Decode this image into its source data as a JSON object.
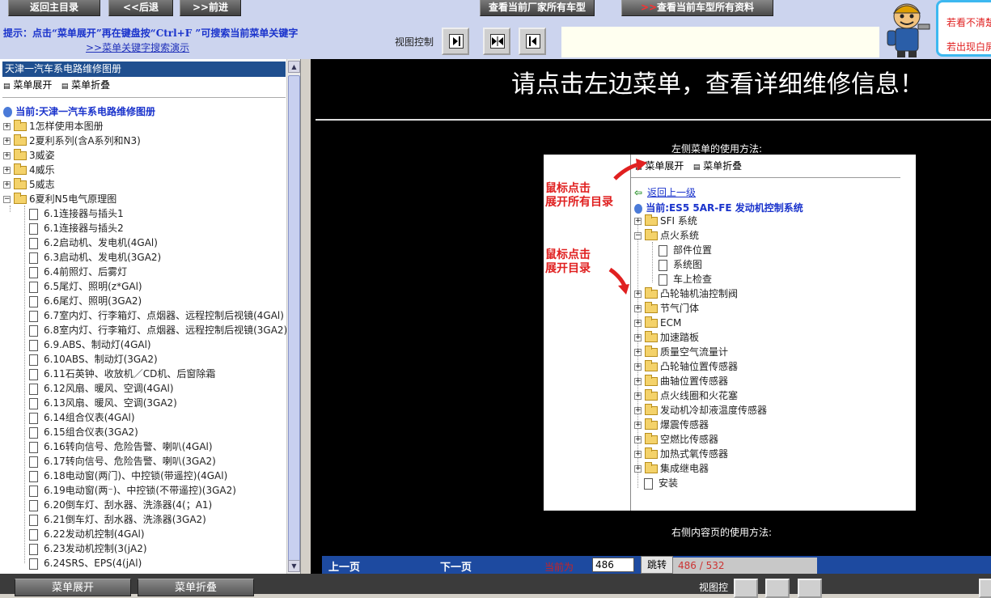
{
  "top": {
    "back_home": "返回主目录",
    "back": "<<后退",
    "forward": ">>前进",
    "all_models": "查看当前厂家所有车型",
    "all_data_arrow": ">>",
    "all_data": "查看当前车型所有资料",
    "hint": "提示：点击“菜单展开”再在键盘按“Ctrl+F ”可搜索当前菜单关键字",
    "hint_link": ">>菜单关键字搜索演示",
    "view_control": "视图控制",
    "promo_line1": "若看不清楚",
    "promo_line2": "若出现白屏"
  },
  "left": {
    "title": "天津一汽车系电路维修图册",
    "expand": "菜单展开",
    "collapse": "菜单折叠",
    "current": "当前:天津一汽车系电路维修图册",
    "folders": [
      "1怎样使用本图册",
      "2夏利系列(含A系列和N3)",
      "3威姿",
      "4威乐",
      "5威志",
      "6夏利N5电气原理图"
    ],
    "items": [
      "6.1连接器与插头1",
      "6.1连接器与插头2",
      "6.2启动机、发电机(4GAl)",
      "6.3启动机、发电机(3GA2)",
      "6.4前照灯、后雾灯",
      "6.5尾灯、照明(z*GAl)",
      "6.6尾灯、照明(3GA2)",
      "6.7室内灯、行李箱灯、点烟器、远程控制后视镜(4GAl)",
      "6.8室内灯、行李箱灯、点烟器、远程控制后视镜(3GA2)",
      "6.9.ABS、制动灯(4GAl)",
      "6.10ABS、制动灯(3GA2)",
      "6.11石英钟、收放机／CD机、后窗除霜",
      "6.12风扇、暖风、空调(4GAl)",
      "6.13风扇、暖风、空调(3GA2)",
      "6.14组合仪表(4GAl)",
      "6.15组合仪表(3GA2)",
      "6.16转向信号、危险告警、喇叭(4GAl)",
      "6.17转向信号、危险告警、喇叭(3GA2)",
      "6.18电动窗(两门)、中控锁(带遥控)(4GAl)",
      "6.19电动窗(两⁻)、中控锁(不带遥控)(3GA2)",
      "6.20倒车灯、刮水器、洗涤器(4(；A1)",
      "6.21倒车灯、刮水器、洗涤器(3GA2)",
      "6.22发动机控制(4GAl)",
      "6.23发动机控制(3(jA2)",
      "6.24SRS、EPS(4(jAl)"
    ]
  },
  "right": {
    "title": "请点击左边菜单，查看详细维修信息！",
    "left_caption": "左侧菜单的使用方法:",
    "right_caption": "右侧内容页的使用方法:",
    "note1_line1": "鼠标点击",
    "note1_line2": "展开所有目录",
    "note2_line1": "鼠标点击",
    "note2_line2": "展开目录",
    "demo": {
      "expand": "菜单展开",
      "collapse": "菜单折叠",
      "back": "返回上一级",
      "current": "当前:ES5 5AR-FE 发动机控制系统",
      "rows": [
        {
          "label": "SFI 系统",
          "kind": "folder"
        },
        {
          "label": "点火系统",
          "kind": "folder-open"
        },
        {
          "label": "部件位置",
          "kind": "doc"
        },
        {
          "label": "系统图",
          "kind": "doc"
        },
        {
          "label": "车上检查",
          "kind": "doc"
        },
        {
          "label": "凸轮轴机油控制阀",
          "kind": "folder"
        },
        {
          "label": "节气门体",
          "kind": "folder"
        },
        {
          "label": "ECM",
          "kind": "folder"
        },
        {
          "label": "加速踏板",
          "kind": "folder"
        },
        {
          "label": "质量空气流量计",
          "kind": "folder"
        },
        {
          "label": "凸轮轴位置传感器",
          "kind": "folder"
        },
        {
          "label": "曲轴位置传感器",
          "kind": "folder"
        },
        {
          "label": "点火线圈和火花塞",
          "kind": "folder"
        },
        {
          "label": "发动机冷却液温度传感器",
          "kind": "folder"
        },
        {
          "label": "爆震传感器",
          "kind": "folder"
        },
        {
          "label": "空燃比传感器",
          "kind": "folder"
        },
        {
          "label": "加热式氧传感器",
          "kind": "folder"
        },
        {
          "label": "集成继电器",
          "kind": "folder"
        },
        {
          "label": "安装",
          "kind": "doc"
        }
      ]
    },
    "nav": {
      "prev": "上一页",
      "next": "下一页",
      "current_label": "当前为",
      "page_value": "486",
      "jump": "跳转",
      "page_count": "486 / 532"
    }
  },
  "bottom": {
    "expand": "菜单展开",
    "collapse": "菜单折叠",
    "view_control": "视图控"
  },
  "colors": {
    "accent_blue": "#1f4f8f",
    "hint_blue": "#1a33cc",
    "note_red": "#e02020",
    "nav_blue": "#1d4aa0"
  }
}
